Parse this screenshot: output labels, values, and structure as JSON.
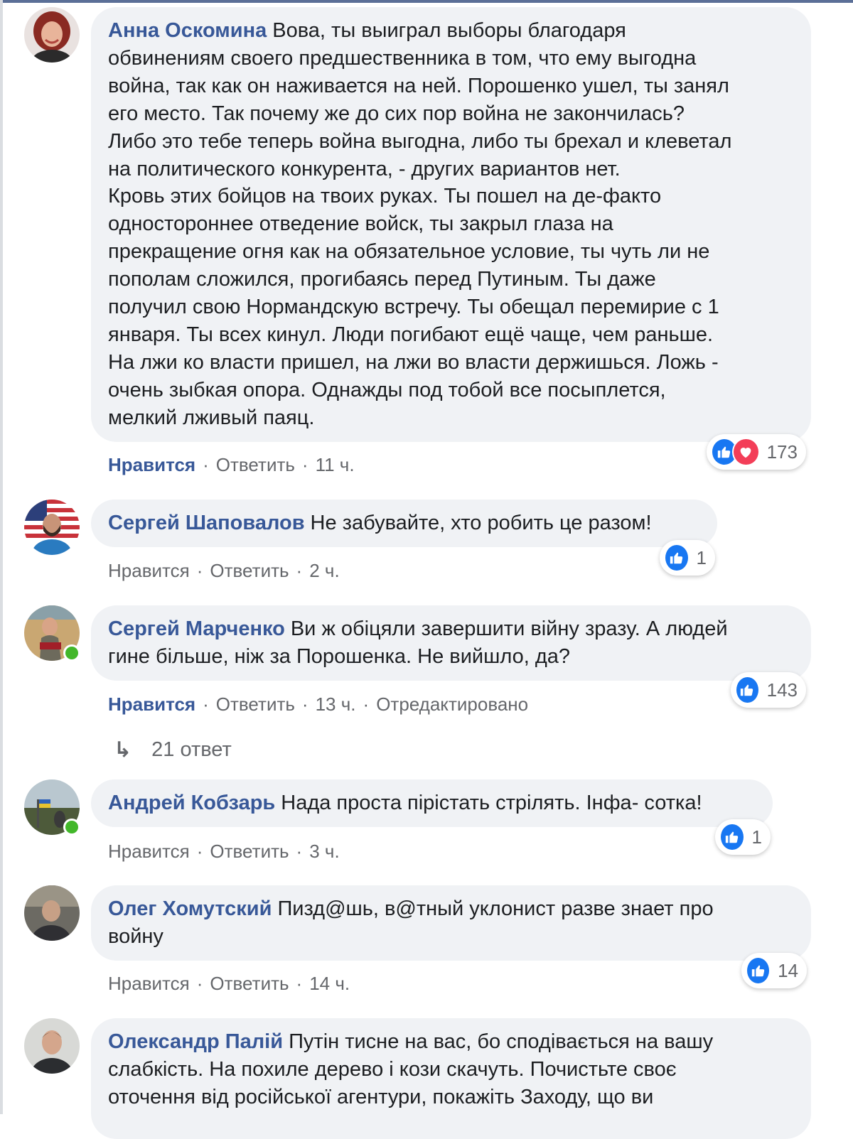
{
  "comments": [
    {
      "author": "Анна Оскомина",
      "text": "Вова, ты выиграл выборы благодаря\nобвинениям своего предшественника в том, что ему выгодна\nвойна, так как он наживается на ней. Порошенко ушел, ты занял\nего место. Так почему же до сих пор война не закончилась?\nЛибо это тебе теперь война выгодна, либо ты брехал и клеветал\nна политического конкурента, - других вариантов нет.\nКровь этих бойцов на твоих руках. Ты пошел на де-факто\nодностороннее отведение войск, ты закрыл глаза на\nпрекращение огня как на обязательное условие, ты чуть ли не\nпополам сложился, прогибаясь перед Путиным. Ты даже\nполучил свою Нормандскую встречу. Ты обещал перемирие с 1\nянваря. Ты всех кинул. Люди погибают ещё чаще, чем раньше.\nНа лжи ко власти пришел, на лжи во власти держишься. Ложь -\nочень зыбкая опора. Однажды под тобой все посыплется,\nмелкий лживый паяц.",
      "like_label": "Нравится",
      "reply_label": "Ответить",
      "time": "11 ч.",
      "reaction_count": "173",
      "reactions": [
        "like-icon",
        "love-icon"
      ]
    },
    {
      "author": "Сергей Шаповалов",
      "text": "Не забувайте, хто робить це разом!",
      "like_label": "Нравится",
      "reply_label": "Ответить",
      "time": "2 ч.",
      "reaction_count": "1",
      "reactions": [
        "like-icon"
      ]
    },
    {
      "author": "Сергей Марченко",
      "text": "Ви ж обіцяли завершити війну зразу. А людей\nгине більше, ніж за Порошенка. Не вийшло, да?",
      "like_label": "Нравится",
      "reply_label": "Ответить",
      "time": "13 ч.",
      "edited": "Отредактировано",
      "reaction_count": "143",
      "reactions": [
        "like-icon"
      ],
      "replies_label": "21 ответ"
    },
    {
      "author": "Андрей Кобзарь",
      "text": "Нада проста пірістать стрілять. Інфа- сотка!",
      "like_label": "Нравится",
      "reply_label": "Ответить",
      "time": "3 ч.",
      "reaction_count": "1",
      "reactions": [
        "like-icon"
      ]
    },
    {
      "author": "Олег Хомутский",
      "text": "Пизд@шь, в@тный уклонист разве знает про\nвойну",
      "like_label": "Нравится",
      "reply_label": "Ответить",
      "time": "14 ч.",
      "reaction_count": "14",
      "reactions": [
        "like-icon"
      ]
    },
    {
      "author": "Олександр Палій",
      "text": "Путін тисне на вас, бо сподівається на вашу\nслабкість. На похиле дерево і кози скачуть. Почистьте своє\nоточення від російської агентури, покажіть Заходу, що ви"
    }
  ],
  "separator": "·",
  "colors": {
    "author": "#385898",
    "bubble": "#f0f2f5",
    "meta": "#65676b",
    "like_reaction": "#1877f2",
    "love_reaction": "#f33e58",
    "online": "#42b72a"
  }
}
